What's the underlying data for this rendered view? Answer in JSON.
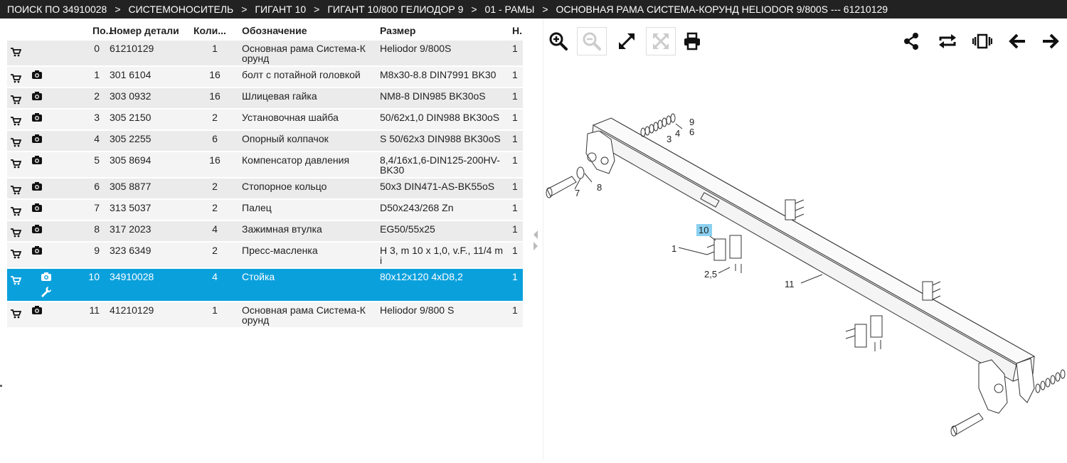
{
  "breadcrumb": {
    "items": [
      "ПОИСК ПО 34910028",
      "СИСТЕМОНОСИТЕЛЬ",
      "ГИГАНТ 10",
      "ГИГАНТ 10/800 ГЕЛИОДОР 9",
      "01 - РАМЫ",
      "ОСНОВНАЯ РАМА СИСТЕМА-КОРУНД HELIODOR 9/800S --- 61210129"
    ],
    "separator": ">"
  },
  "table": {
    "headers": {
      "pos": "По...",
      "part_no": "Номер детали",
      "qty": "Коли...",
      "name": "Обозначение",
      "size": "Размер",
      "n": "Н..."
    },
    "rows": [
      {
        "pos": "0",
        "part_no": "61210129",
        "qty": "1",
        "name": "Основная рама Система-К орунд",
        "size": "Heliodor 9/800S",
        "n": "1",
        "cart": true,
        "camera": false,
        "wrench": false,
        "selected": false
      },
      {
        "pos": "1",
        "part_no": "301 6104",
        "qty": "16",
        "name": "болт с потайной головкой",
        "size": "M8x30-8.8 DIN7991 BK30",
        "n": "1",
        "cart": true,
        "camera": true,
        "wrench": false,
        "selected": false
      },
      {
        "pos": "2",
        "part_no": "303 0932",
        "qty": "16",
        "name": "Шлицевая гайка",
        "size": "NM8-8 DIN985 BK30oS",
        "n": "1",
        "cart": true,
        "camera": true,
        "wrench": false,
        "selected": false
      },
      {
        "pos": "3",
        "part_no": "305 2150",
        "qty": "2",
        "name": "Установочная шайба",
        "size": "50/62x1,0 DIN988 BK30oS",
        "n": "1",
        "cart": true,
        "camera": true,
        "wrench": false,
        "selected": false
      },
      {
        "pos": "4",
        "part_no": "305 2255",
        "qty": "6",
        "name": "Опорный колпачок",
        "size": "S 50/62x3 DIN988 BK30oS",
        "n": "1",
        "cart": true,
        "camera": true,
        "wrench": false,
        "selected": false
      },
      {
        "pos": "5",
        "part_no": "305 8694",
        "qty": "16",
        "name": "Компенсатор давления",
        "size": "8,4/16x1,6-DIN125-200HV-BK30",
        "n": "1",
        "cart": true,
        "camera": true,
        "wrench": false,
        "selected": false
      },
      {
        "pos": "6",
        "part_no": "305 8877",
        "qty": "2",
        "name": "Стопорное кольцо",
        "size": "50x3 DIN471-AS-BK55oS",
        "n": "1",
        "cart": true,
        "camera": true,
        "wrench": false,
        "selected": false
      },
      {
        "pos": "7",
        "part_no": "313 5037",
        "qty": "2",
        "name": "Палец",
        "size": "D50x243/268 Zn",
        "n": "1",
        "cart": true,
        "camera": true,
        "wrench": false,
        "selected": false
      },
      {
        "pos": "8",
        "part_no": "317 2023",
        "qty": "4",
        "name": "Зажимная втулка",
        "size": "EG50/55x25",
        "n": "1",
        "cart": true,
        "camera": true,
        "wrench": false,
        "selected": false
      },
      {
        "pos": "9",
        "part_no": "323 6349",
        "qty": "2",
        "name": "Пресс-масленка",
        "size": "H 3, m 10 x 1,0, v.F., 11/4 m i",
        "n": "1",
        "cart": true,
        "camera": true,
        "wrench": false,
        "selected": false
      },
      {
        "pos": "10",
        "part_no": "34910028",
        "qty": "4",
        "name": "Стойка",
        "size": "80x12x120 4xD8,2",
        "n": "1",
        "cart": true,
        "camera": true,
        "wrench": true,
        "selected": true
      },
      {
        "pos": "11",
        "part_no": "41210129",
        "qty": "1",
        "name": "Основная рама Система-К орунд",
        "size": "Heliodor 9/800 S",
        "n": "1",
        "cart": true,
        "camera": true,
        "wrench": false,
        "selected": false
      }
    ]
  },
  "toolbar": {
    "left": [
      "zoom-in-icon",
      "zoom-out-icon",
      "fit-expand-icon",
      "fit-reset-icon",
      "print-icon"
    ],
    "right": [
      "share-icon",
      "repeat-icon",
      "carousel-icon",
      "arrow-left-icon",
      "arrow-right-icon"
    ]
  },
  "drawing": {
    "labels": [
      "9",
      "3",
      "4",
      "6",
      "7",
      "8",
      "10",
      "1",
      "2,5",
      "11"
    ]
  },
  "colors": {
    "topbar_bg": "#222222",
    "selected_row": "#0aa0dc",
    "row_bg": "#ebebeb",
    "callout_highlight": "#8ad0f0"
  }
}
